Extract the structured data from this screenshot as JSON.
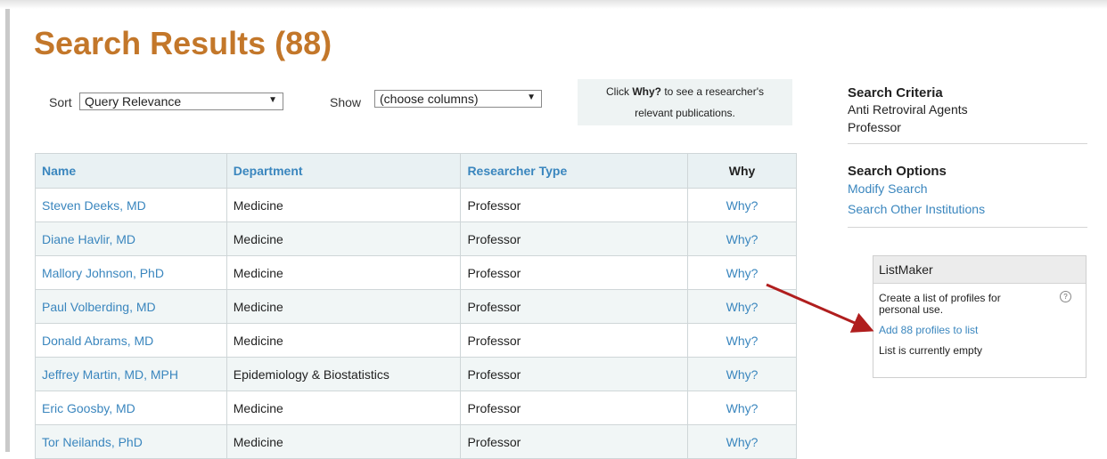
{
  "page": {
    "title": "Search Results (88)"
  },
  "controls": {
    "sort_label": "Sort",
    "sort_value": "Query Relevance",
    "show_label": "Show",
    "show_value": "(choose columns)",
    "tip_prefix": "Click ",
    "tip_bold": "Why?",
    "tip_line1_suffix": " to see a researcher's",
    "tip_line2": "relevant publications."
  },
  "table": {
    "headers": {
      "name": "Name",
      "department": "Department",
      "type": "Researcher Type",
      "why": "Why"
    },
    "rows": [
      {
        "name": "Steven Deeks, MD",
        "department": "Medicine",
        "type": "Professor",
        "why": "Why?"
      },
      {
        "name": "Diane Havlir, MD",
        "department": "Medicine",
        "type": "Professor",
        "why": "Why?"
      },
      {
        "name": "Mallory Johnson, PhD",
        "department": "Medicine",
        "type": "Professor",
        "why": "Why?"
      },
      {
        "name": "Paul Volberding, MD",
        "department": "Medicine",
        "type": "Professor",
        "why": "Why?"
      },
      {
        "name": "Donald Abrams, MD",
        "department": "Medicine",
        "type": "Professor",
        "why": "Why?"
      },
      {
        "name": "Jeffrey Martin, MD, MPH",
        "department": "Epidemiology & Biostatistics",
        "type": "Professor",
        "why": "Why?"
      },
      {
        "name": "Eric Goosby, MD",
        "department": "Medicine",
        "type": "Professor",
        "why": "Why?"
      },
      {
        "name": "Tor Neilands, PhD",
        "department": "Medicine",
        "type": "Professor",
        "why": "Why?"
      }
    ]
  },
  "sidebar": {
    "criteria_heading": "Search Criteria",
    "criteria": [
      "Anti Retroviral Agents",
      "Professor"
    ],
    "options_heading": "Search Options",
    "modify_search": "Modify Search",
    "other_institutions": "Search Other Institutions"
  },
  "listmaker": {
    "title": "ListMaker",
    "description": "Create a list of profiles for personal use.",
    "help_icon": "question-circle-icon",
    "help_glyph": "?",
    "add_link": "Add 88 profiles to list",
    "status": "List is currently empty"
  },
  "colors": {
    "title": "#c3772a",
    "link": "#3a86be",
    "annotation_arrow": "#b01e1e"
  }
}
